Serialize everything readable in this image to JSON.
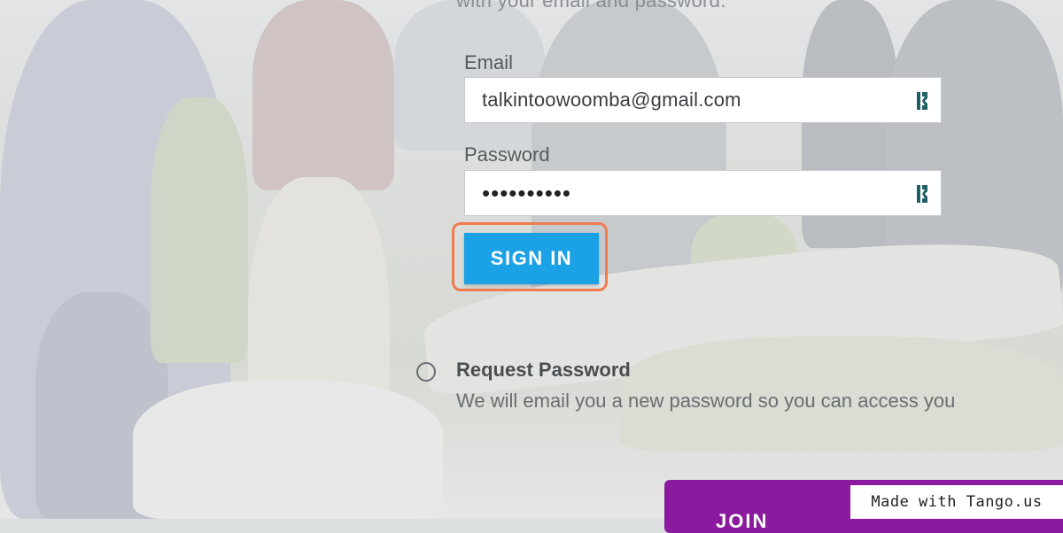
{
  "page": {
    "top_text": "with your email and password."
  },
  "form": {
    "email_label": "Email",
    "email_value": "talkintoowoomba@gmail.com",
    "password_label": "Password",
    "password_value": "••••••••••",
    "signin_label": "SIGN IN"
  },
  "request_password": {
    "title": "Request Password",
    "description": "We will email you a new password so you can access you"
  },
  "footer": {
    "purple_button_label": "JOIN",
    "watermark": "Made with Tango.us"
  },
  "colors": {
    "primary_button": "#1ba1e6",
    "highlight_ring": "#f07b4e",
    "purple_button": "#8c1a9e",
    "password_manager_icon": "#1f5f66"
  },
  "icons": {
    "password_manager": "keeper-icon",
    "radio": "radio-unchecked-icon"
  }
}
